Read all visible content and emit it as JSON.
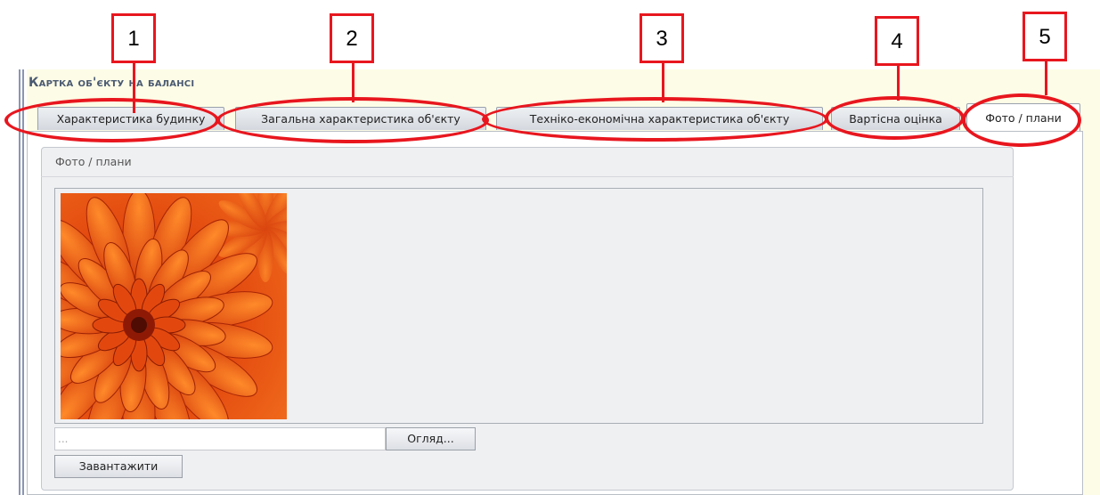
{
  "page": {
    "title": "Картка об'єкту на балансі"
  },
  "tabs": [
    {
      "label": "Характеристика будинку",
      "active": false
    },
    {
      "label": "Загальна характеристика об'єкту",
      "active": false
    },
    {
      "label": "Техніко-економічна характеристика об'єкту",
      "active": false
    },
    {
      "label": "Вартісна оцінка",
      "active": false
    },
    {
      "label": "Фото / плани",
      "active": true
    }
  ],
  "section": {
    "title": "Фото / плани"
  },
  "upload": {
    "file_value": "...",
    "browse_label": "Огляд...",
    "upload_label": "Завантажити"
  },
  "callouts": [
    "1",
    "2",
    "3",
    "4",
    "5"
  ],
  "colors": {
    "callout_red": "#e8161e",
    "title_text": "#4a5a72",
    "header_bg": "#fdfce6"
  },
  "photo": {
    "subject": "orange chrysanthemum flower"
  }
}
